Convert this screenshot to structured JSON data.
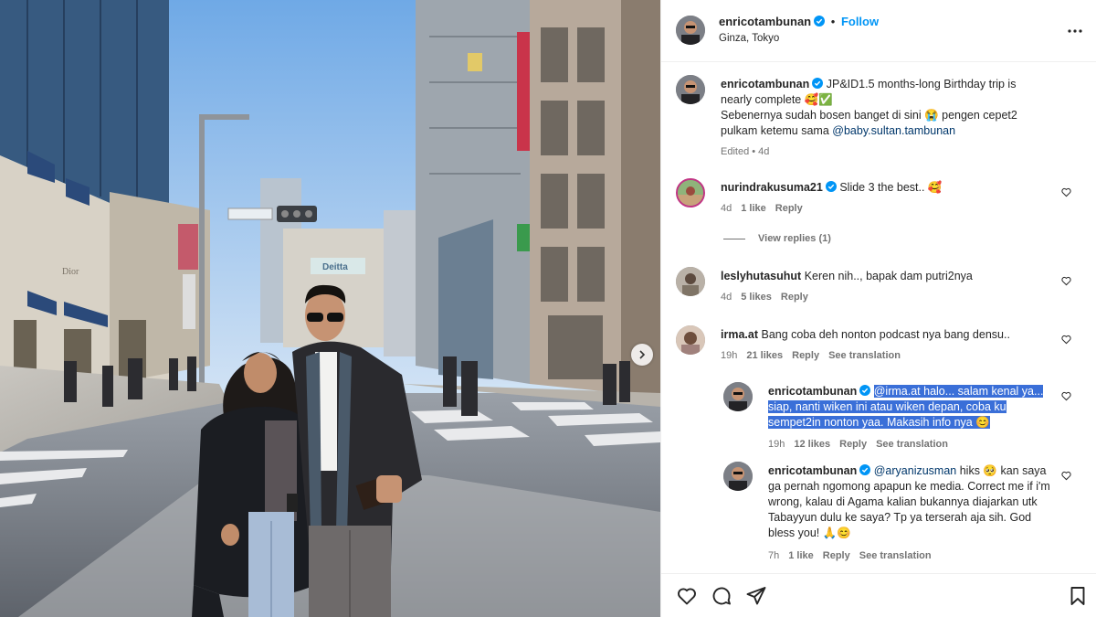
{
  "post": {
    "username": "enricotambunan",
    "follow_label": "Follow",
    "location": "Ginza, Tokyo",
    "more_icon": "more-horizontal-icon"
  },
  "photo": {
    "sign_left": "Dior",
    "sign_center": "Deitta"
  },
  "caption": {
    "username": "enricotambunan",
    "line1": "JP&ID1.5 months-long Birthday trip is nearly complete 🥰✅",
    "line2": "Sebenernya sudah bosen banget di sini 😭 pengen cepet2 pulkam ketemu sama ",
    "mention": "@baby.sultan.tambunan",
    "time": "Edited • 4d"
  },
  "comments": [
    {
      "username": "nurindrakusuma21",
      "verified": true,
      "text": "Slide 3 the best.. 🥰",
      "time": "4d",
      "likes": "1 like",
      "reply": "Reply",
      "view_replies": "View replies (1)"
    },
    {
      "username": "leslyhutasuhut",
      "verified": false,
      "text": "Keren nih.., bapak dam putri2nya",
      "time": "4d",
      "likes": "5 likes",
      "reply": "Reply"
    },
    {
      "username": "irma.at",
      "verified": false,
      "text": "Bang coba deh nonton podcast nya bang densu..",
      "time": "19h",
      "likes": "21 likes",
      "reply": "Reply",
      "translation": "See translation"
    },
    {
      "username": "enricotambunan",
      "verified": true,
      "mention": "@irma.at",
      "text": " halo... salam kenal ya... siap, nanti wiken ini atau wiken depan, coba ku sempet2in nonton yaa. Makasih info nya 😊",
      "time": "19h",
      "likes": "12 likes",
      "reply": "Reply",
      "translation": "See translation"
    },
    {
      "username": "enricotambunan",
      "verified": true,
      "mention": "@aryanizusman",
      "text": " hiks 🥺 kan saya ga pernah ngomong apapun ke media. Correct me if i'm wrong, kalau di Agama kalian bukannya diajarkan utk Tabayyun dulu ke saya? Tp ya terserah aja sih. God bless you! 🙏😊",
      "time": "7h",
      "likes": "1 like",
      "reply": "Reply",
      "translation": "See translation"
    }
  ],
  "actions": {
    "like": "heart-icon",
    "comment": "comment-icon",
    "share": "share-icon",
    "save": "bookmark-icon"
  },
  "colors": {
    "accent": "#0095f6",
    "verified": "#0095f6",
    "highlight": "#3a6fd8"
  }
}
